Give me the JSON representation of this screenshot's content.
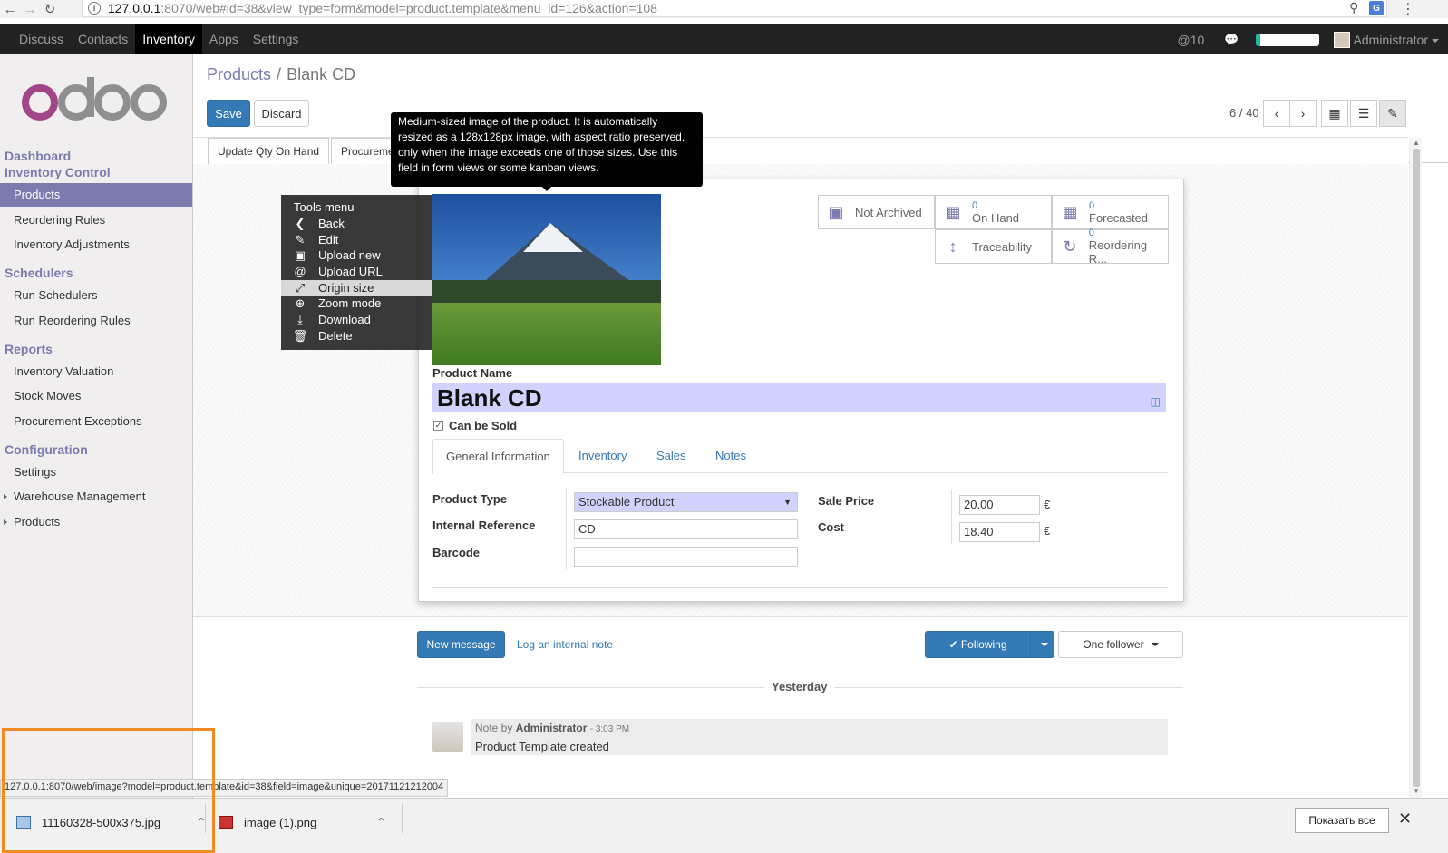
{
  "browser": {
    "url_host": "127.0.0.1",
    "url_rest": ":8070/web#id=38&view_type=form&model=product.template&menu_id=126&action=108"
  },
  "topbar": {
    "menu": [
      "Discuss",
      "Contacts",
      "Inventory",
      "Apps",
      "Settings"
    ],
    "active": "Inventory",
    "mentions": "@10",
    "user": "Administrator"
  },
  "sidebar": {
    "brand": "odoo",
    "dashboard": "Dashboard",
    "inventory_control": "Inventory Control",
    "items_ic": [
      "Products",
      "Reordering Rules",
      "Inventory Adjustments"
    ],
    "schedulers": "Schedulers",
    "items_sched": [
      "Run Schedulers",
      "Run Reordering Rules"
    ],
    "reports": "Reports",
    "items_reports": [
      "Inventory Valuation",
      "Stock Moves",
      "Procurement Exceptions"
    ],
    "configuration": "Configuration",
    "items_config": [
      "Settings",
      "Warehouse Management",
      "Products"
    ]
  },
  "breadcrumb": {
    "parent": "Products",
    "separator": "/",
    "current": "Blank CD"
  },
  "buttons": {
    "save": "Save",
    "discard": "Discard"
  },
  "pager": "6 / 40",
  "status_buttons": [
    "Update Qty On Hand",
    "Procurement"
  ],
  "tooltip": "Medium-sized image of the product. It is automatically resized as a 128x128px image, with aspect ratio preserved, only when the image exceeds one of those sizes. Use this field in form views or some kanban views.",
  "tools_menu": {
    "title": "Tools menu",
    "items": [
      "Back",
      "Edit",
      "Upload new",
      "Upload URL",
      "Origin size",
      "Zoom mode",
      "Download",
      "Delete"
    ],
    "highlighted": "Origin size"
  },
  "stats": {
    "archived": "Not Archived",
    "on_hand_value": "0",
    "on_hand_label": "On Hand",
    "forecasted_value": "0",
    "forecasted_label": "Forecasted",
    "traceability": "Traceability",
    "reordering_value": "0",
    "reordering_label": "Reordering R..."
  },
  "form": {
    "product_name_label": "Product Name",
    "product_name": "Blank CD",
    "can_be_sold": "Can be Sold",
    "tabs": [
      "General Information",
      "Inventory",
      "Sales",
      "Notes"
    ],
    "product_type_label": "Product Type",
    "product_type": "Stockable Product",
    "internal_ref_label": "Internal Reference",
    "internal_ref": "CD",
    "barcode_label": "Barcode",
    "barcode": "",
    "sale_price_label": "Sale Price",
    "sale_price": "20.00",
    "cost_label": "Cost",
    "cost": "18.40",
    "currency": "€"
  },
  "chatter": {
    "new_message": "New message",
    "log_note": "Log an internal note",
    "following": "✔ Following",
    "followers": "One follower",
    "date_separator": "Yesterday",
    "note_prefix": "Note by",
    "author": "Administrator",
    "time": "- 3:03 PM",
    "body": "Product Template created"
  },
  "status_url": "127.0.0.1:8070/web/image?model=product.template&id=38&field=image&unique=20171121212004",
  "downloads": {
    "files": [
      "11160328-500x375.jpg",
      "image (1).png"
    ],
    "show_all": "Показать все"
  },
  "colors": {
    "accent": "#7c7bad",
    "primary": "#337ab7",
    "topbar": "#222222",
    "highlight": "#f08a24"
  }
}
